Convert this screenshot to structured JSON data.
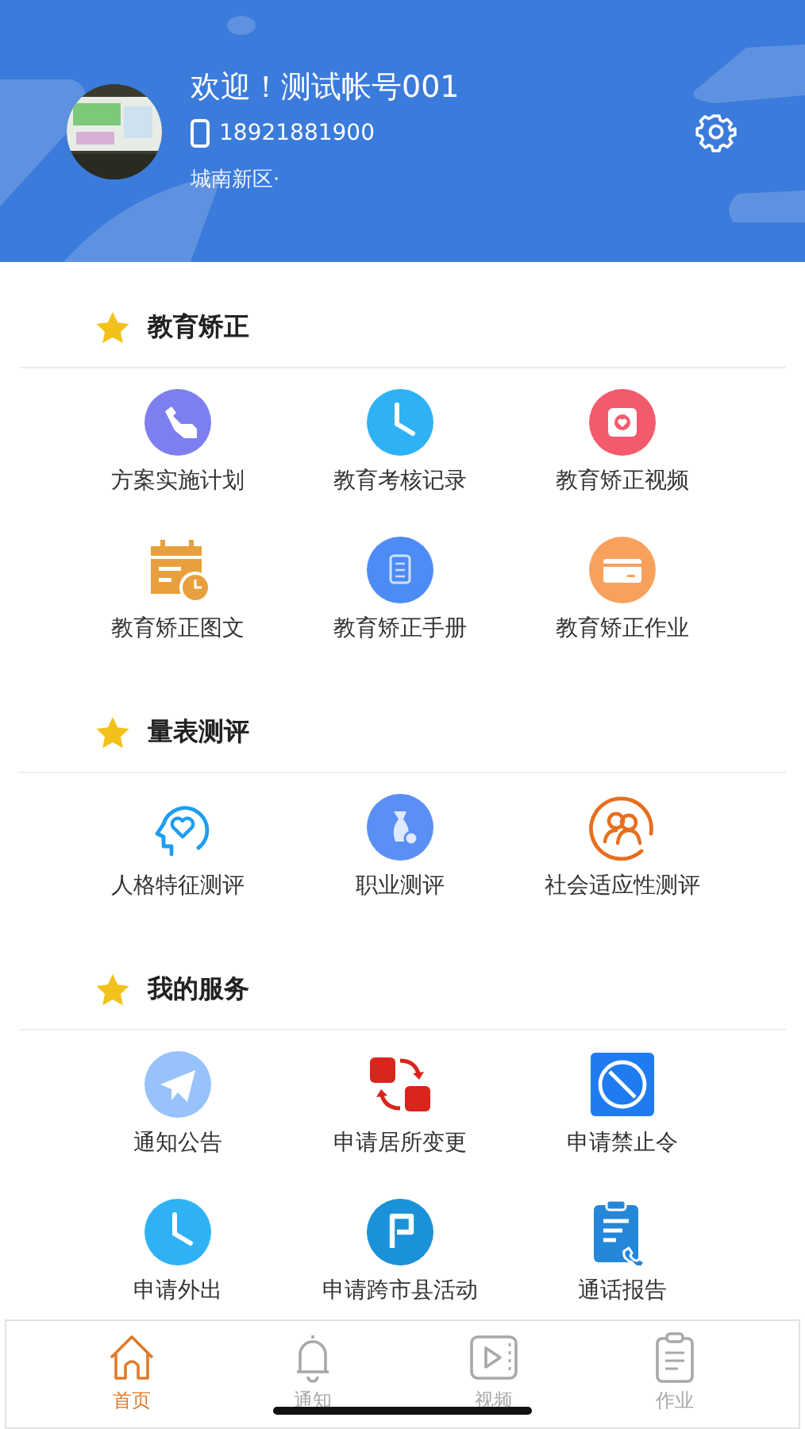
{
  "profile": {
    "greeting": "欢迎！测试帐号001",
    "phone": "18921881900",
    "district": "城南新区·"
  },
  "sections": [
    {
      "title": "教育矫正",
      "items": [
        {
          "label": "方案实施计划"
        },
        {
          "label": "教育考核记录"
        },
        {
          "label": "教育矫正视频"
        },
        {
          "label": "教育矫正图文"
        },
        {
          "label": "教育矫正手册"
        },
        {
          "label": "教育矫正作业"
        }
      ]
    },
    {
      "title": "量表测评",
      "items": [
        {
          "label": "人格特征测评"
        },
        {
          "label": "职业测评"
        },
        {
          "label": "社会适应性测评"
        }
      ]
    },
    {
      "title": "我的服务",
      "items": [
        {
          "label": "通知公告"
        },
        {
          "label": "申请居所变更"
        },
        {
          "label": "申请禁止令"
        },
        {
          "label": "申请外出"
        },
        {
          "label": "申请跨市县活动"
        },
        {
          "label": "通话报告"
        }
      ]
    }
  ],
  "tabs": [
    {
      "label": "首页",
      "selected": true
    },
    {
      "label": "通知",
      "selected": false
    },
    {
      "label": "视频",
      "selected": false
    },
    {
      "label": "作业",
      "selected": false
    }
  ]
}
